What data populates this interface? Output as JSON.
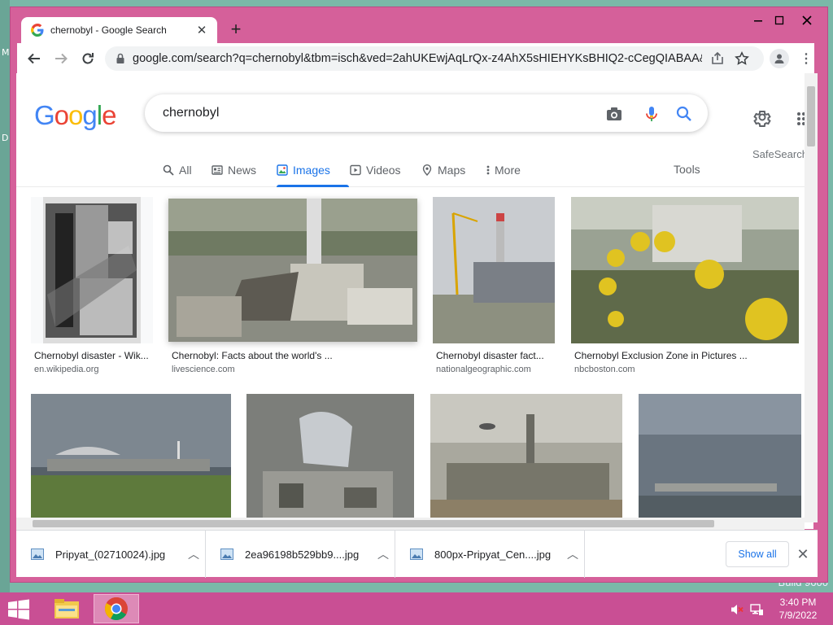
{
  "desktop": {
    "glyphs": [
      "M",
      "D"
    ],
    "build_label": "Build 9600"
  },
  "browser": {
    "tab_title": "chernobyl - Google Search",
    "url": "google.com/search?q=chernobyl&tbm=isch&ved=2ahUKEwjAqLrQx-z4AhX5sHIEHYKsBHIQ2-cCegQIABAA&oq..."
  },
  "google": {
    "logo": [
      "G",
      "o",
      "o",
      "g",
      "l",
      "e"
    ],
    "logo_colors": [
      "#4285f4",
      "#ea4335",
      "#fbbc05",
      "#4285f4",
      "#34a853",
      "#ea4335"
    ],
    "query": "chernobyl",
    "safesearch_label": "SafeSearch",
    "tabs": [
      {
        "label": "All",
        "icon": "search-icon"
      },
      {
        "label": "News",
        "icon": "news-icon"
      },
      {
        "label": "Images",
        "icon": "images-icon",
        "active": true
      },
      {
        "label": "Videos",
        "icon": "video-icon"
      },
      {
        "label": "Maps",
        "icon": "map-pin-icon"
      },
      {
        "label": "More",
        "icon": "kebab-icon"
      }
    ],
    "tools_label": "Tools",
    "accent_color": "#1a73e8"
  },
  "results": [
    {
      "title": "Chernobyl disaster - Wik...",
      "source": "en.wikipedia.org"
    },
    {
      "title": "Chernobyl: Facts about the world's ...",
      "source": "livescience.com"
    },
    {
      "title": "Chernobyl disaster fact...",
      "source": "nationalgeographic.com"
    },
    {
      "title": "Chernobyl Exclusion Zone in Pictures ...",
      "source": "nbcboston.com"
    },
    {
      "title": "",
      "source": ""
    },
    {
      "title": "",
      "source": ""
    },
    {
      "title": "",
      "source": ""
    },
    {
      "title": "",
      "source": ""
    }
  ],
  "downloads": {
    "items": [
      {
        "name": "Pripyat_(02710024).jpg"
      },
      {
        "name": "2ea96198b529bb9....jpg"
      },
      {
        "name": "800px-Pripyat_Cen....jpg"
      }
    ],
    "show_all_label": "Show all"
  },
  "taskbar": {
    "time": "3:40 PM",
    "date": "7/9/2022",
    "color": "#c94f94"
  }
}
